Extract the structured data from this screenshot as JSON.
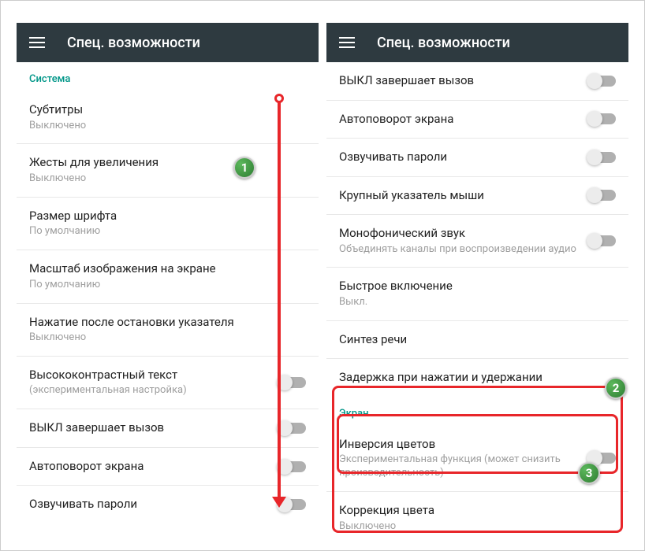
{
  "appbar_title": "Спец. возможности",
  "left": {
    "section": "Система",
    "items": [
      {
        "title": "Субтитры",
        "sub": "Выключено",
        "toggle": false
      },
      {
        "title": "Жесты для увеличения",
        "sub": "Выключено",
        "toggle": false
      },
      {
        "title": "Размер шрифта",
        "sub": "По умолчанию",
        "toggle": false
      },
      {
        "title": "Масштаб изображения на экране",
        "sub": "По умолчанию",
        "toggle": false
      },
      {
        "title": "Нажатие после остановки указателя",
        "sub": "Выключено",
        "toggle": false
      },
      {
        "title": "Высококонтрастный текст",
        "sub": "(экспериментальная настройка)",
        "toggle": true
      },
      {
        "title": "ВЫКЛ завершает вызов",
        "sub": "",
        "toggle": true
      },
      {
        "title": "Автоповорот экрана",
        "sub": "",
        "toggle": true
      },
      {
        "title": "Озвучивать пароли",
        "sub": "",
        "toggle": true
      }
    ]
  },
  "right": {
    "items_top": [
      {
        "title": "ВЫКЛ завершает вызов",
        "sub": "",
        "toggle": true
      },
      {
        "title": "Автоповорот экрана",
        "sub": "",
        "toggle": true
      },
      {
        "title": "Озвучивать пароли",
        "sub": "",
        "toggle": true
      },
      {
        "title": "Крупный указатель мыши",
        "sub": "",
        "toggle": true
      },
      {
        "title": "Монофонический звук",
        "sub": "Объединять каналы при воспроизведении аудио",
        "toggle": true
      },
      {
        "title": "Быстрое включение",
        "sub": "Выкл.",
        "toggle": false
      },
      {
        "title": "Синтез речи",
        "sub": "",
        "toggle": false
      },
      {
        "title": "Задержка при нажатии и удержании",
        "sub": "",
        "toggle": false
      }
    ],
    "section2": "Экран",
    "items_bottom": [
      {
        "title": "Инверсия цветов",
        "sub": "Экспериментальная функция (может снизить производительность)",
        "toggle": true
      },
      {
        "title": "Коррекция цвета",
        "sub": "Выключено",
        "toggle": false
      }
    ]
  },
  "badges": {
    "b1": "1",
    "b2": "2",
    "b3": "3"
  }
}
